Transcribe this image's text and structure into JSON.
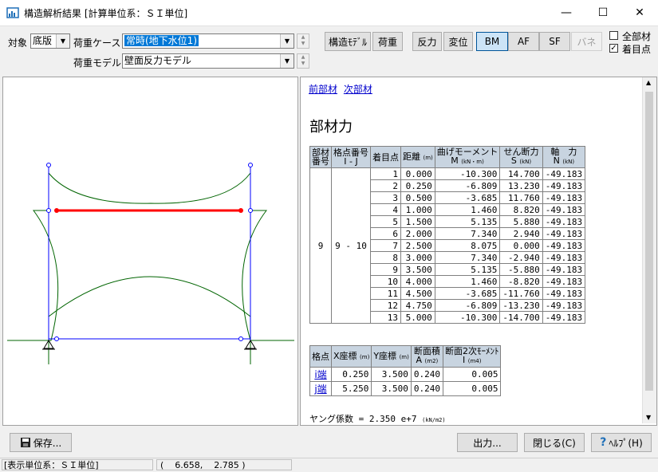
{
  "window": {
    "title": "構造解析結果  [計算単位系：ＳＩ単位]",
    "minimize": "—",
    "maximize": "☐",
    "close": "✕"
  },
  "toolbar": {
    "target_label": "対象",
    "target_value": "底版",
    "load_case_label": "荷重ケース",
    "load_case_value": "常時(地下水位1)",
    "load_model_label": "荷重モデル",
    "load_model_value": "壁面反力モデル",
    "structure_model_btn": "構造ﾓﾃﾞﾙ",
    "load_btn": "荷重",
    "reaction_btn": "反力",
    "displacement_btn": "変位",
    "bm_btn": "BM",
    "af_btn": "AF",
    "sf_btn": "SF",
    "spring_btn": "バネ",
    "all_members_label": "全部材",
    "focus_point_label": "着目点"
  },
  "detail": {
    "prev_member": "前部材",
    "next_member": "次部材",
    "heading": "部材力",
    "force_table": {
      "headers": {
        "member_no": [
          "部材",
          "番号"
        ],
        "node_no": [
          "格点番号",
          "I - J"
        ],
        "point": "着目点",
        "distance": "距離",
        "distance_unit": "(m)",
        "moment": "曲げモーメント",
        "moment_sub": "M",
        "moment_unit": "(kN・m)",
        "shear": "せん断力",
        "shear_sub": "S",
        "shear_unit": "(kN)",
        "axial": "軸　力",
        "axial_sub": "N",
        "axial_unit": "(kN)"
      },
      "member_no": "9",
      "node_no": "9 - 10",
      "rows": [
        [
          "1",
          "0.000",
          "-10.300",
          "14.700",
          "-49.183"
        ],
        [
          "2",
          "0.250",
          "-6.809",
          "13.230",
          "-49.183"
        ],
        [
          "3",
          "0.500",
          "-3.685",
          "11.760",
          "-49.183"
        ],
        [
          "4",
          "1.000",
          "1.460",
          "8.820",
          "-49.183"
        ],
        [
          "5",
          "1.500",
          "5.135",
          "5.880",
          "-49.183"
        ],
        [
          "6",
          "2.000",
          "7.340",
          "2.940",
          "-49.183"
        ],
        [
          "7",
          "2.500",
          "8.075",
          "0.000",
          "-49.183"
        ],
        [
          "8",
          "3.000",
          "7.340",
          "-2.940",
          "-49.183"
        ],
        [
          "9",
          "3.500",
          "5.135",
          "-5.880",
          "-49.183"
        ],
        [
          "10",
          "4.000",
          "1.460",
          "-8.820",
          "-49.183"
        ],
        [
          "11",
          "4.500",
          "-3.685",
          "-11.760",
          "-49.183"
        ],
        [
          "12",
          "4.750",
          "-6.809",
          "-13.230",
          "-49.183"
        ],
        [
          "13",
          "5.000",
          "-10.300",
          "-14.700",
          "-49.183"
        ]
      ]
    },
    "node_table": {
      "headers": {
        "node": "格点",
        "x": "X座標",
        "x_unit": "(m)",
        "y": "Y座標",
        "y_unit": "(m)",
        "area": "断面積",
        "area_sub": "A",
        "area_unit": "(m2)",
        "inertia": "断面2次ﾓｰﾒﾝﾄ",
        "inertia_sub": "I",
        "inertia_unit": "(m4)"
      },
      "rows": [
        {
          "node": "i端",
          "x": "0.250",
          "y": "3.500",
          "a": "0.240",
          "i": "0.005"
        },
        {
          "node": "j端",
          "x": "5.250",
          "y": "3.500",
          "a": "0.240",
          "i": "0.005"
        }
      ]
    },
    "young_label": "ヤング係数 = 2.350 e+7",
    "young_unit": "(kN/m2)"
  },
  "bottom": {
    "save_btn": "保存...",
    "output_btn": "出力...",
    "close_btn": "閉じる(C)",
    "help_btn": "ﾍﾙﾌﾟ(H)"
  },
  "status": {
    "units": "[表示単位系：ＳＩ単位]",
    "coords": "(    6.658,    2.785 )"
  },
  "colors": {
    "frame": "#0000ff",
    "moment": "#006400",
    "selected_member": "#ff0000",
    "table_header": "#c8d4e0"
  }
}
